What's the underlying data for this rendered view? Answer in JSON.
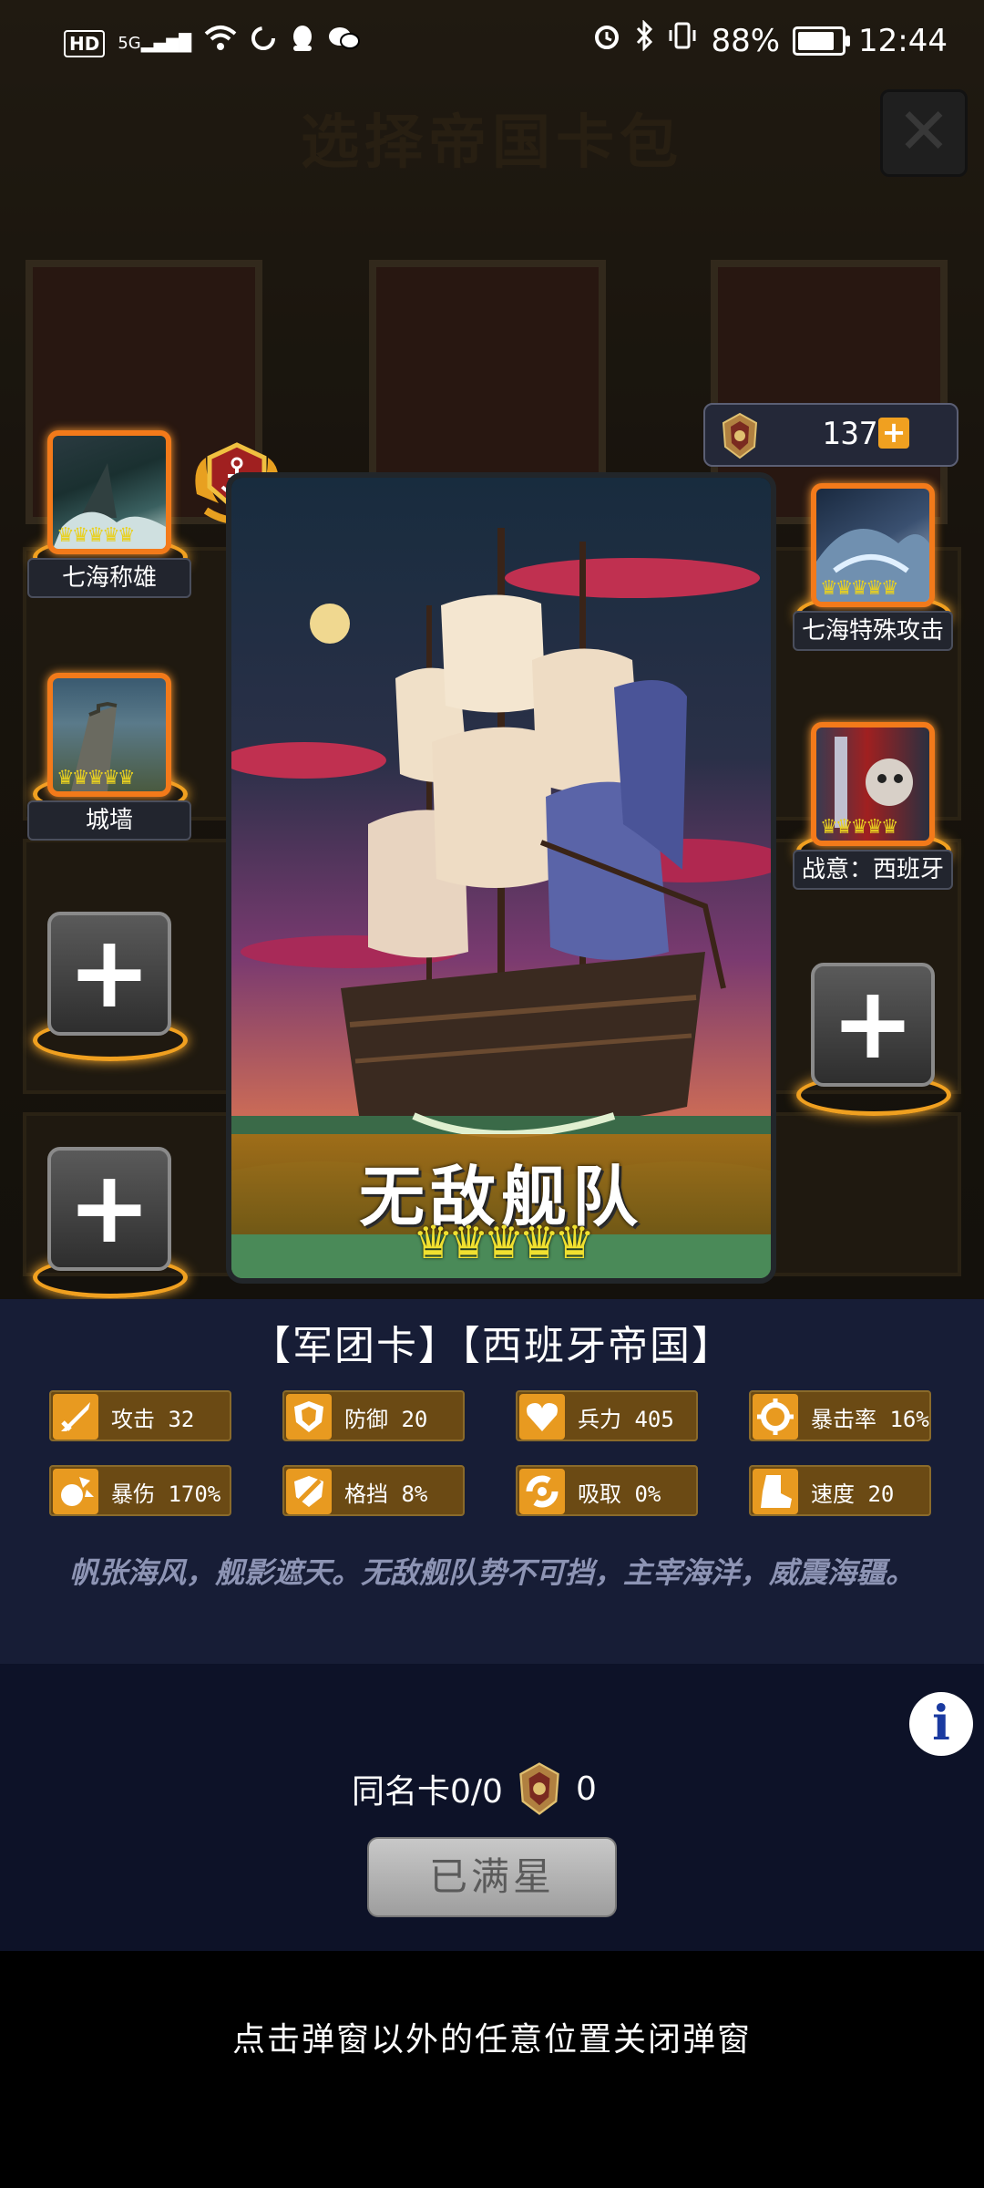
{
  "status_bar": {
    "signal": "5G",
    "hd": "HD",
    "battery": "88%",
    "battery_level": 0.88,
    "time": "12:44"
  },
  "background": {
    "title": "选择帝国卡包"
  },
  "resource": {
    "value": "137"
  },
  "left_slots": [
    {
      "label": "七海称雄",
      "crowns": "♛♛♛♛♛"
    },
    {
      "label": "城墙",
      "crowns": "♛♛♛♛♛"
    }
  ],
  "right_slots": [
    {
      "label": "七海特殊攻击",
      "crowns": "♛♛♛♛♛"
    },
    {
      "label": "战意：西班牙",
      "crowns": "♛♛♛♛♛"
    }
  ],
  "add_slot_symbol": "+",
  "card": {
    "name": "无敌舰队",
    "stars": "♛♛♛♛♛"
  },
  "tags": "【军团卡】【西班牙帝国】",
  "stats": [
    {
      "label": "攻击 32",
      "icon": "sword-icon"
    },
    {
      "label": "防御 20",
      "icon": "shield-icon"
    },
    {
      "label": "兵力 405",
      "icon": "heart-icon"
    },
    {
      "label": "暴击率 16%",
      "icon": "crosshair-icon"
    },
    {
      "label": "暴伤 170%",
      "icon": "burst-icon"
    },
    {
      "label": "格挡 8%",
      "icon": "block-icon"
    },
    {
      "label": "吸取 0%",
      "icon": "drain-icon"
    },
    {
      "label": "速度 20",
      "icon": "boot-icon"
    }
  ],
  "description": "帆张海风，舰影遮天。无敌舰队势不可挡，主宰海洋，威震海疆。",
  "info_symbol": "i",
  "duplicate": {
    "label": "同名卡0/0",
    "count": "0"
  },
  "full_star_button": "已满星",
  "close_hint": "点击弹窗以外的任意位置关闭弹窗",
  "colors": {
    "accent_orange": "#f37a1a",
    "panel_bg": "#171d36",
    "stat_bg": "#6b4a14",
    "crown_yellow": "#f0e030"
  }
}
